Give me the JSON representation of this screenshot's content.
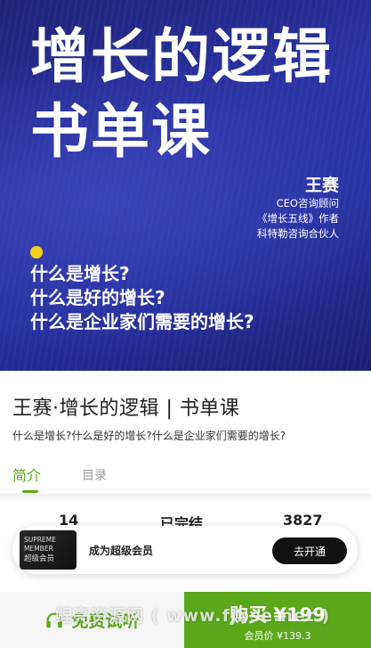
{
  "hero": {
    "title_line1": "增长的逻辑",
    "title_line2": "书单课",
    "author_name": "王赛",
    "author_role1": "CEO咨询顾问",
    "author_role2": "《增长五线》作者",
    "author_role3": "科特勒咨询合伙人",
    "questions": [
      "什么是增长?",
      "什么是好的增长?",
      "什么是企业家们需要的增长?"
    ]
  },
  "course": {
    "title": "王赛·增长的逻辑 | 书单课",
    "subtitle": "什么是增长?什么是好的增长?什么是企业家们需要的增长?"
  },
  "tabs": [
    {
      "label": "简介",
      "active": true
    },
    {
      "label": "目录",
      "active": false
    }
  ],
  "stats": [
    "14",
    "已完结",
    "3827"
  ],
  "member": {
    "badge_line1": "SUPREME",
    "badge_line2": "MEMBER",
    "badge_line3": "超级会员",
    "text": "成为超级会员",
    "button": "去开通"
  },
  "bottom": {
    "trial_label": "免费试听",
    "buy_label": "购买 ¥199",
    "member_price": "会员价 ¥139.3"
  },
  "watermark": "鲤亮资源网 ( www.fjbse.net )",
  "colors": {
    "accent": "#5aa81a",
    "hero_bg": "#2430a0",
    "dot": "#f4d21c"
  }
}
